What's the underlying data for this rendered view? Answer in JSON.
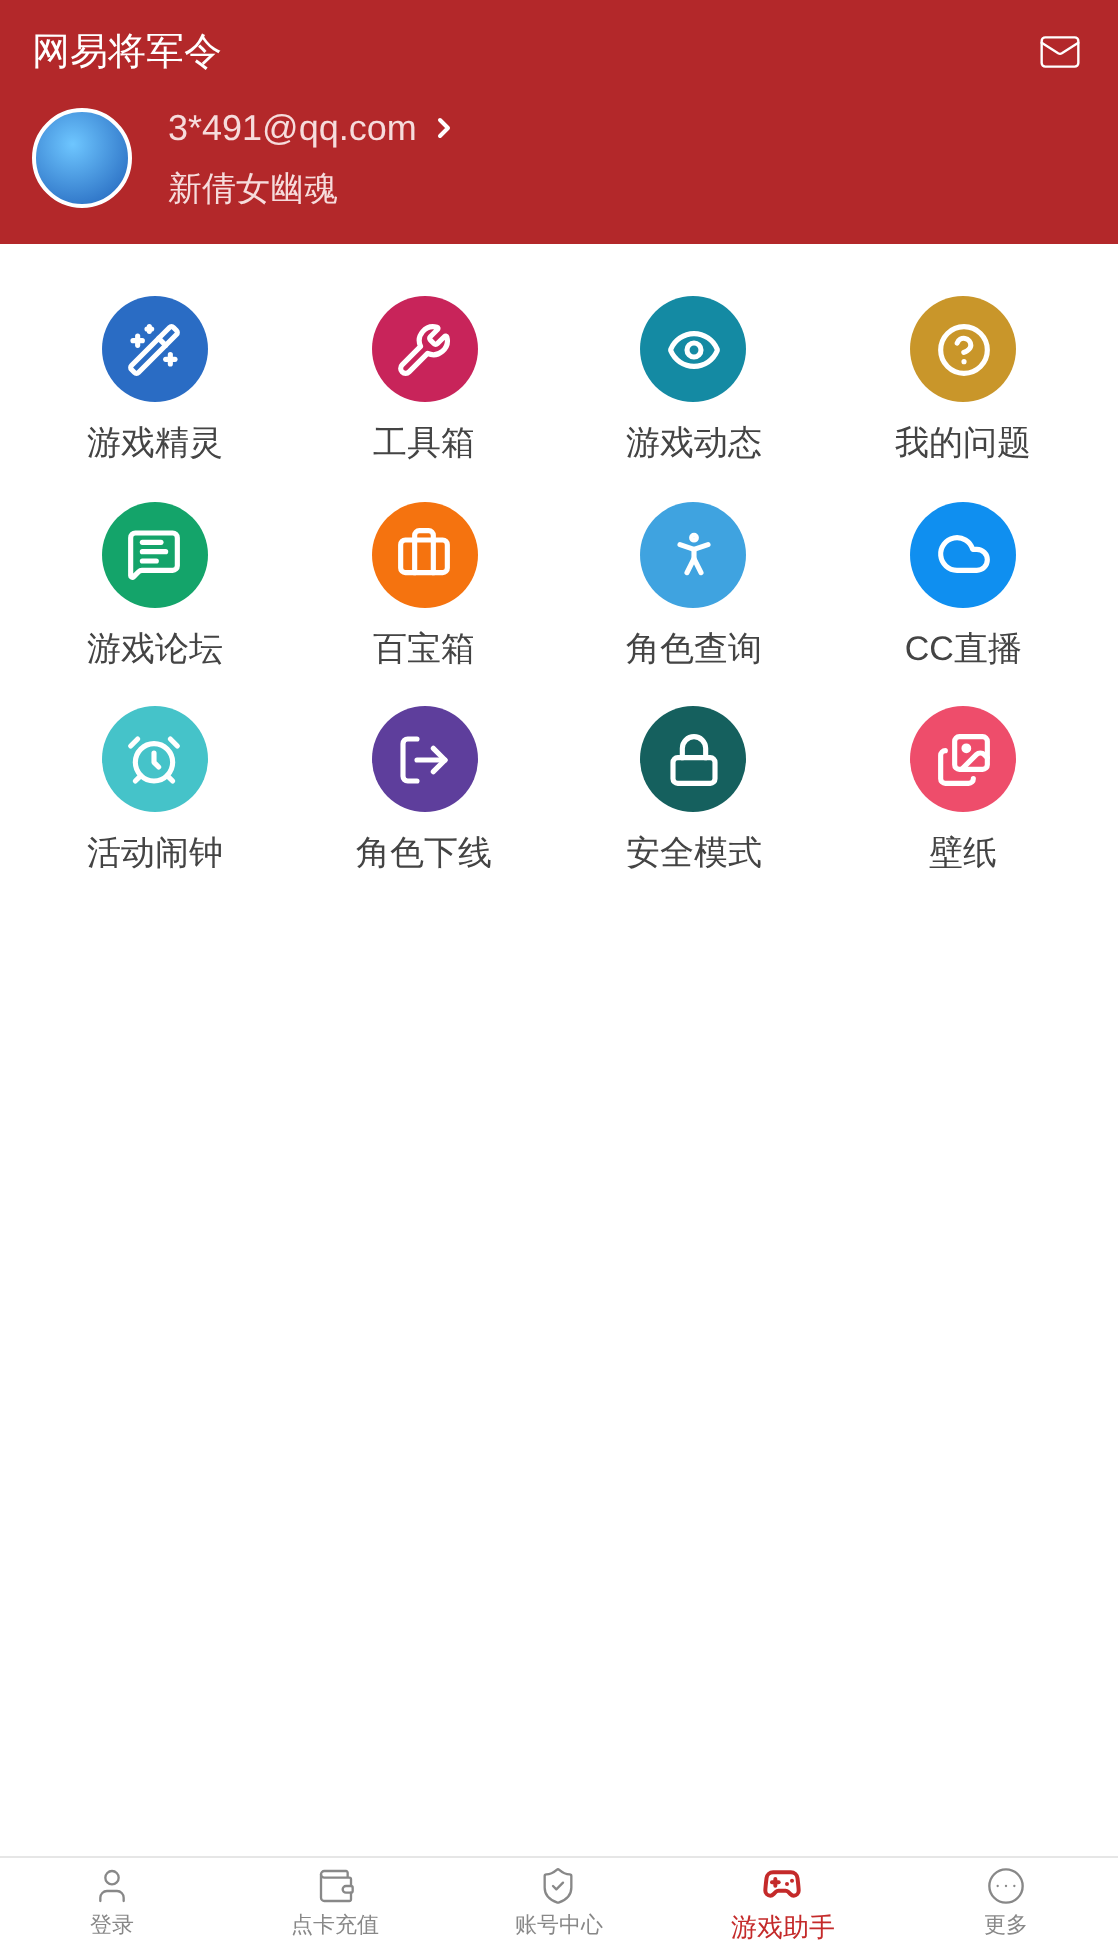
{
  "header": {
    "title": "网易将军令",
    "account": "3*491@qq.com",
    "game": "新倩女幽魂"
  },
  "grid": [
    {
      "label": "游戏精灵",
      "color": "#2a6cc4"
    },
    {
      "label": "工具箱",
      "color": "#c8245a"
    },
    {
      "label": "游戏动态",
      "color": "#148aa3"
    },
    {
      "label": "我的问题",
      "color": "#c9962a"
    },
    {
      "label": "游戏论坛",
      "color": "#14a46a"
    },
    {
      "label": "百宝箱",
      "color": "#f5730f"
    },
    {
      "label": "角色查询",
      "color": "#3fa3e0"
    },
    {
      "label": "CC直播",
      "color": "#0f8ff0"
    },
    {
      "label": "活动闹钟",
      "color": "#45c3c9"
    },
    {
      "label": "角色下线",
      "color": "#5e3e9c"
    },
    {
      "label": "安全模式",
      "color": "#15605e"
    },
    {
      "label": "壁纸",
      "color": "#ee4d6b"
    }
  ],
  "tabs": [
    {
      "label": "登录",
      "selected": false
    },
    {
      "label": "点卡充值",
      "selected": false
    },
    {
      "label": "账号中心",
      "selected": false
    },
    {
      "label": "游戏助手",
      "selected": true
    },
    {
      "label": "更多",
      "selected": false
    }
  ]
}
